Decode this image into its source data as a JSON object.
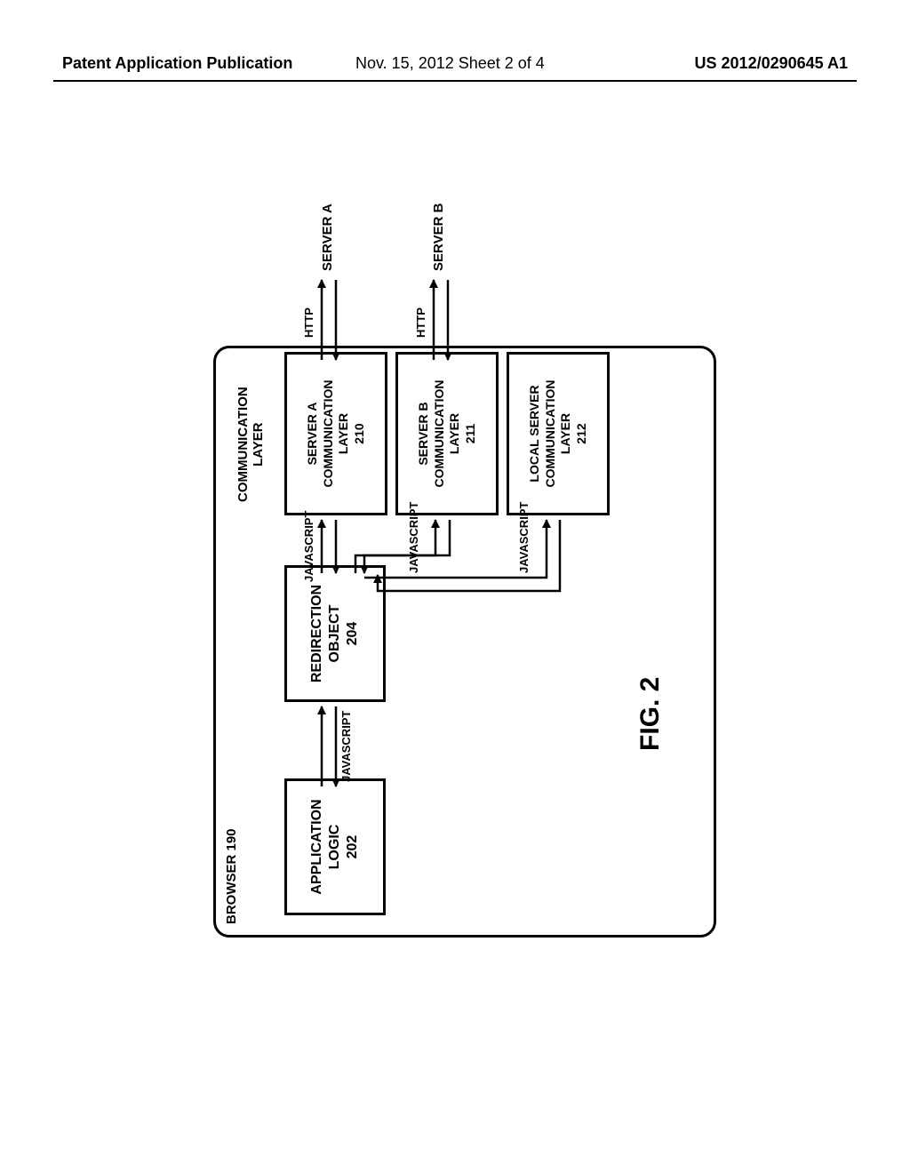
{
  "header": {
    "left": "Patent Application Publication",
    "mid": "Nov. 15, 2012  Sheet 2 of 4",
    "right": "US 2012/0290645 A1"
  },
  "figure_caption": "FIG. 2",
  "browser_label": "BROWSER  190",
  "comm_layer_group": "COMMUNICATION\nLAYER",
  "boxes": {
    "app_logic": "APPLICATION\nLOGIC\n202",
    "redirection": "REDIRECTION\nOBJECT\n204",
    "srv_a_comm": "SERVER A\nCOMMUNICATION\nLAYER\n210",
    "srv_b_comm": "SERVER B\nCOMMUNICATION\nLAYER\n211",
    "local_comm": "LOCAL SERVER\nCOMMUNICATION\nLAYER\n212"
  },
  "link_labels": {
    "js": "JAVASCRIPT",
    "http": "HTTP"
  },
  "external": {
    "server_a": "SERVER A",
    "server_b": "SERVER B"
  }
}
